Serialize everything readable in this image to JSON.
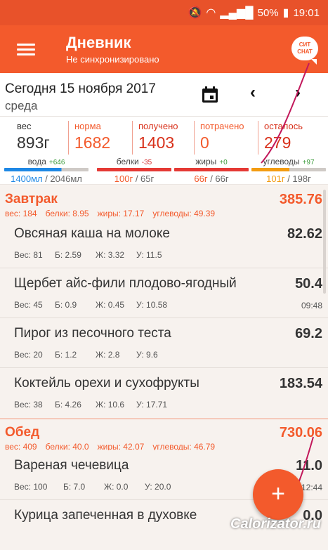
{
  "status_bar": {
    "battery_percent": "50%",
    "time": "19:01"
  },
  "app_bar": {
    "title": "Дневник",
    "subtitle": "Не синхронизировано",
    "chat_icon_text_1": "СИТ",
    "chat_icon_text_2": "CHAT"
  },
  "date": {
    "main": "Сегодня 15 ноября 2017",
    "weekday": "среда",
    "prev": "‹",
    "next": "›"
  },
  "summary": {
    "stats": [
      {
        "label": "вес",
        "value": "893г",
        "color": "#333333"
      },
      {
        "label": "норма",
        "value": "1682",
        "color": "#f35a2c"
      },
      {
        "label": "получено",
        "value": "1403",
        "color": "#d8301a"
      },
      {
        "label": "потрачено",
        "value": "0",
        "color": "#f35a2c"
      },
      {
        "label": "осталось",
        "value": "279",
        "color": "#d8301a"
      }
    ],
    "macros": [
      {
        "label": "вода",
        "delta": "+646",
        "delta_color": "#3a9a3a",
        "value": "1400мл",
        "norm": "/ 2046мл",
        "bar_color": "#1e88e5",
        "fill": 0.684,
        "value_color": "#1e88e5"
      },
      {
        "label": "белки",
        "delta": "-35",
        "delta_color": "#d32f2f",
        "value": "100г",
        "norm": "/ 65г",
        "bar_color": "#e53935",
        "fill": 1,
        "value_color": "#f35a2c"
      },
      {
        "label": "жиры",
        "delta": "+0",
        "delta_color": "#3a9a3a",
        "value": "66г",
        "norm": "/ 66г",
        "bar_color": "#e53935",
        "fill": 1,
        "value_color": "#f35a2c"
      },
      {
        "label": "углеводы",
        "delta": "+97",
        "delta_color": "#3a9a3a",
        "value": "101г",
        "norm": "/ 198г",
        "bar_color": "#f39c12",
        "fill": 0.51,
        "value_color": "#f39c12"
      }
    ]
  },
  "meals": [
    {
      "name": "Завтрак",
      "total": "385.76",
      "macros": [
        "вес: 184",
        "белки: 8.95",
        "жиры: 17.17",
        "углеводы: 49.39"
      ],
      "items": [
        {
          "name": "Овсяная каша на молоке",
          "kcal": "82.62",
          "meta": [
            "Вес: 81",
            "Б: 2.59",
            "Ж: 3.32",
            "У: 11.5"
          ],
          "time": ""
        },
        {
          "name": "Щербет айс-фили плодово-ягодный",
          "kcal": "50.4",
          "meta": [
            "Вес: 45",
            "Б: 0.9",
            "Ж: 0.45",
            "У: 10.58"
          ],
          "time": "09:48"
        },
        {
          "name": "Пирог из песочного теста",
          "kcal": "69.2",
          "meta": [
            "Вес: 20",
            "Б: 1.2",
            "Ж: 2.8",
            "У: 9.6"
          ],
          "time": ""
        },
        {
          "name": "Коктейль орехи и сухофрукты",
          "kcal": "183.54",
          "meta": [
            "Вес: 38",
            "Б: 4.26",
            "Ж: 10.6",
            "У: 17.71"
          ],
          "time": ""
        }
      ]
    },
    {
      "name": "Обед",
      "total": "730.06",
      "macros": [
        "вес: 409",
        "белки: 40.0",
        "жиры: 42.07",
        "углеводы: 46.79"
      ],
      "items": [
        {
          "name": "Вареная чечевица",
          "kcal": "11.0",
          "meta": [
            "Вес: 100",
            "Б: 7.0",
            "Ж: 0.0",
            "У: 20.0"
          ],
          "time": "12:44"
        },
        {
          "name": "Курица запеченная в духовке",
          "kcal": "0.0",
          "meta": [],
          "time": ""
        }
      ]
    }
  ],
  "fab": {
    "label": "+"
  },
  "watermark": "Calorizator.ru"
}
